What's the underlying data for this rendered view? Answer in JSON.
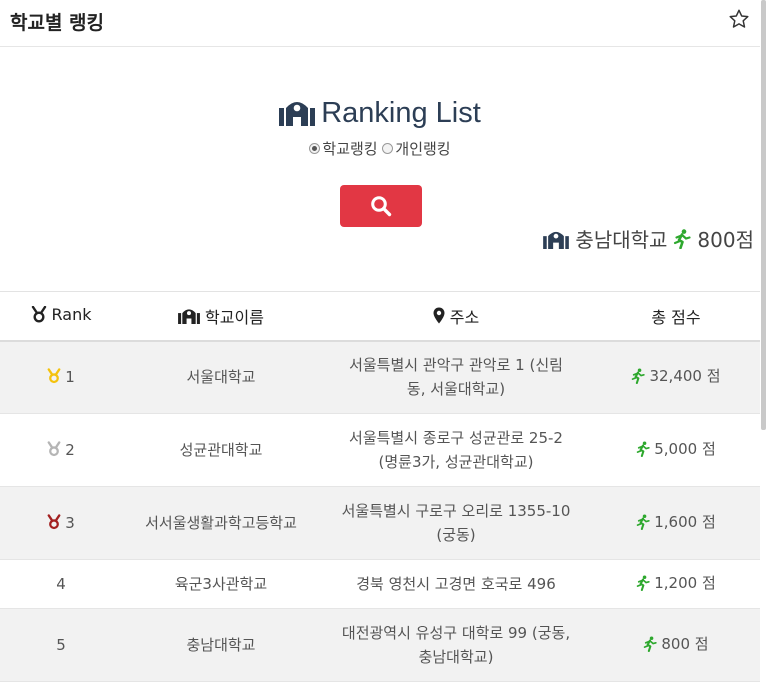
{
  "header": {
    "title": "학교별 랭킹",
    "star_icon": "star-outline-icon"
  },
  "hero": {
    "title": "Ranking List",
    "icon": "school-icon"
  },
  "filters": {
    "option_school": "학교랭킹",
    "option_personal": "개인랭킹",
    "selected": "학교랭킹"
  },
  "search": {
    "icon": "search-icon",
    "color": "#e23744"
  },
  "my_school": {
    "name": "충남대학교",
    "score": "800점"
  },
  "table": {
    "headers": {
      "rank": "Rank",
      "school": "학교이름",
      "address": "주소",
      "score": "총 점수"
    },
    "rows": [
      {
        "rank": "1",
        "medal": "gold",
        "school": "서울대학교",
        "address": "서울특별시 관악구 관악로 1 (신림동, 서울대학교)",
        "score": "32,400 점"
      },
      {
        "rank": "2",
        "medal": "silver",
        "school": "성균관대학교",
        "address": "서울특별시 종로구 성균관로 25-2 (명륜3가, 성균관대학교)",
        "score": "5,000 점"
      },
      {
        "rank": "3",
        "medal": "bronze",
        "school": "서서울생활과학고등학교",
        "address": "서울특별시 구로구 오리로 1355-10 (궁동)",
        "score": "1,600 점"
      },
      {
        "rank": "4",
        "medal": "",
        "school": "육군3사관학교",
        "address": "경북 영천시 고경면 호국로 496",
        "score": "1,200 점"
      },
      {
        "rank": "5",
        "medal": "",
        "school": "충남대학교",
        "address": "대전광역시 유성구 대학로 99 (궁동, 충남대학교)",
        "score": "800 점"
      }
    ]
  },
  "colors": {
    "accent_red": "#e23744",
    "runner_green": "#2ea82e",
    "gold": "#f4c20d",
    "silver": "#b5b5b5",
    "bronze": "#a32020",
    "title_navy": "#2c3e55"
  }
}
